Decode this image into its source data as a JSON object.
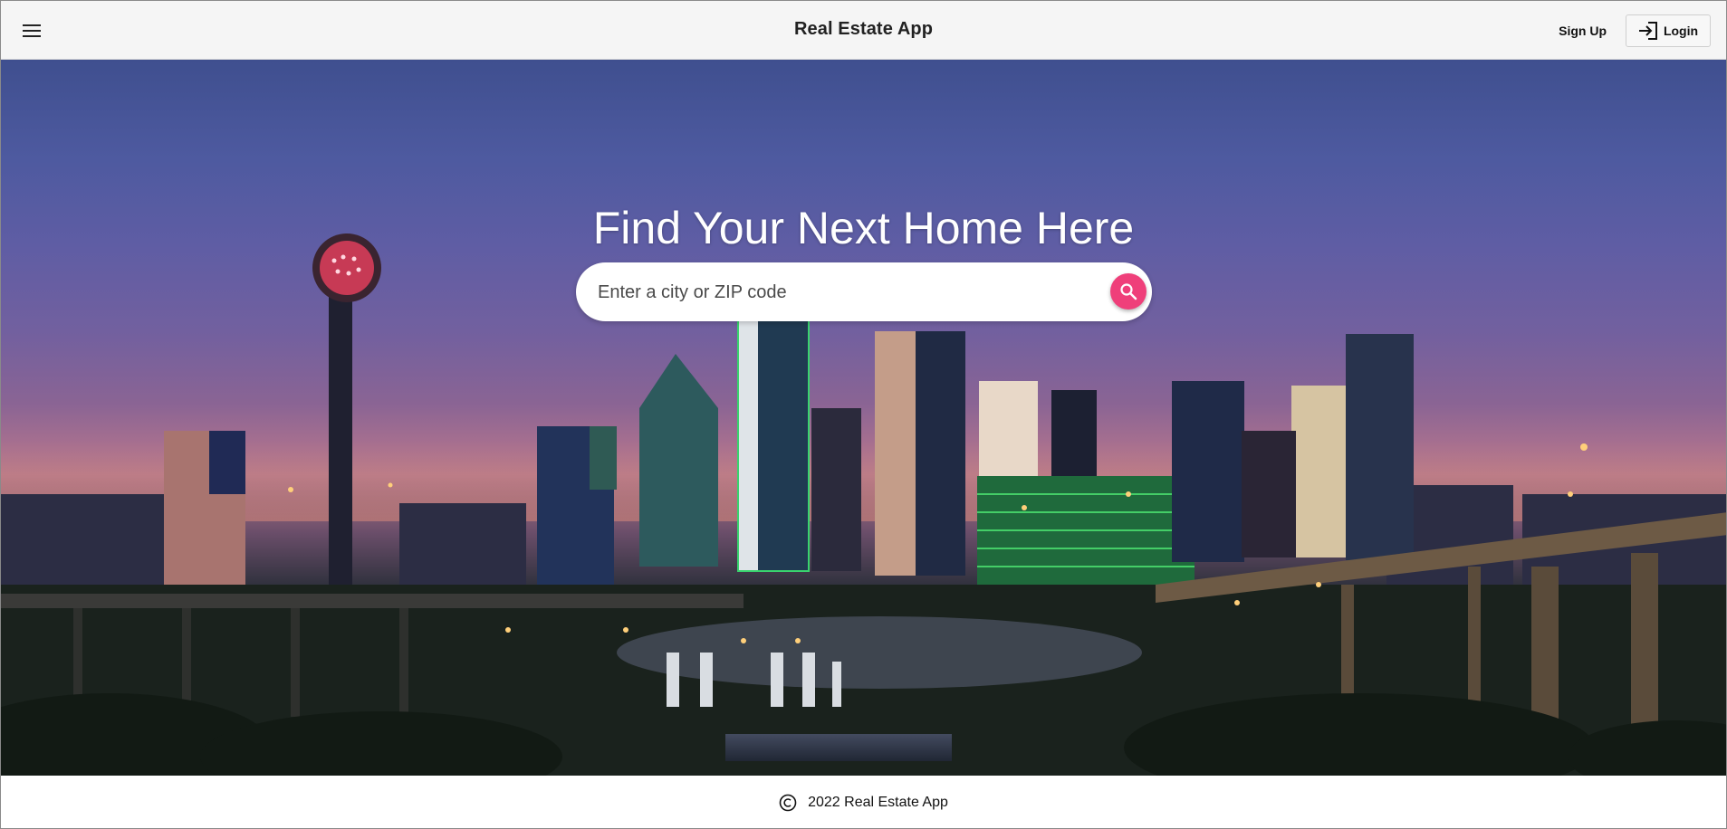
{
  "header": {
    "title": "Real Estate App",
    "menu_icon": "hamburger-menu-icon",
    "signup_label": "Sign Up",
    "login_label": "Login",
    "login_icon": "login-icon"
  },
  "hero": {
    "heading": "Find Your Next Home Here",
    "background": "city-skyline-at-dusk",
    "search": {
      "value": "",
      "placeholder": "Enter a city or ZIP code",
      "button_icon": "search-icon",
      "button_color": "#ef3f7a"
    }
  },
  "footer": {
    "copyright_icon": "copyright-icon",
    "text": "2022 Real Estate App"
  },
  "colors": {
    "header_bg": "#f5f5f5",
    "accent": "#ef3f7a",
    "hero_text": "#ffffff"
  }
}
